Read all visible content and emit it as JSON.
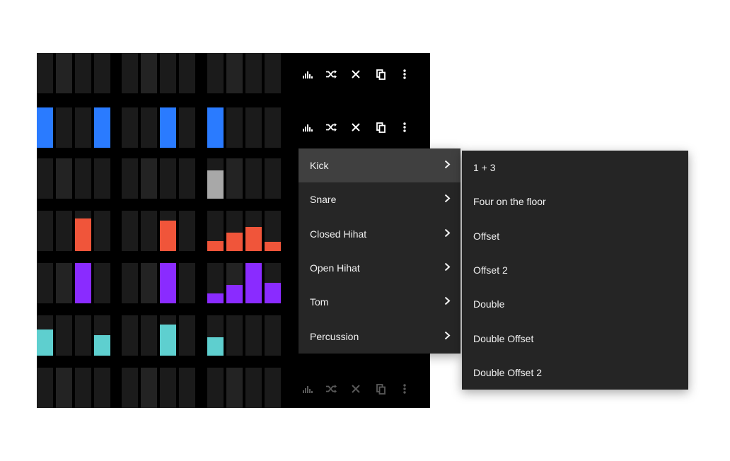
{
  "sequencer": {
    "tracks": [
      {
        "color": "#2a7bff",
        "steps": [
          0,
          0,
          0,
          0,
          0,
          0,
          0,
          0,
          0,
          0,
          0,
          0
        ]
      },
      {
        "color": "#2a7bff",
        "steps": [
          1,
          0,
          0,
          1,
          0,
          0,
          1,
          0,
          1,
          0,
          0,
          0
        ]
      },
      {
        "color": "#a8a8a8",
        "steps": [
          0,
          0,
          0,
          0,
          0,
          0,
          0,
          0,
          0.7,
          0,
          0,
          0
        ]
      },
      {
        "color": "#f0553a",
        "steps": [
          0,
          0,
          0.8,
          0,
          0,
          0,
          0.75,
          0,
          0.25,
          0.45,
          0.6,
          0.22
        ]
      },
      {
        "color": "#8a2bff",
        "steps": [
          0,
          0,
          1,
          0,
          0,
          0,
          1,
          0,
          0.25,
          0.45,
          1,
          0.5
        ]
      },
      {
        "color": "#5ecfcf",
        "steps": [
          0.65,
          0,
          0,
          0.5,
          0,
          0,
          0.78,
          0,
          0.45,
          0,
          0,
          0
        ]
      },
      {
        "color": "#2a7bff",
        "steps": [
          0,
          0,
          0,
          0,
          0,
          0,
          0,
          0,
          0,
          0,
          0,
          0
        ]
      }
    ],
    "row_tools": [
      {
        "dim": false,
        "icons": [
          "velocity-icon",
          "shuffle-icon",
          "clear-icon",
          "copy-icon",
          "more-icon"
        ]
      },
      {
        "dim": false,
        "icons": [
          "velocity-icon",
          "shuffle-icon",
          "clear-icon",
          "copy-icon",
          "more-icon"
        ]
      },
      {
        "dim": true,
        "icons": [
          "velocity-icon",
          "shuffle-icon",
          "clear-icon",
          "copy-icon",
          "more-icon"
        ]
      }
    ]
  },
  "track_menu": {
    "items": [
      {
        "label": "Kick",
        "active": true
      },
      {
        "label": "Snare",
        "active": false
      },
      {
        "label": "Closed Hihat",
        "active": false
      },
      {
        "label": "Open Hihat",
        "active": false
      },
      {
        "label": "Tom",
        "active": false
      },
      {
        "label": "Percussion",
        "active": false
      }
    ]
  },
  "pattern_menu": {
    "items": [
      {
        "label": "1 + 3"
      },
      {
        "label": "Four on the floor"
      },
      {
        "label": "Offset"
      },
      {
        "label": "Offset 2"
      },
      {
        "label": "Double"
      },
      {
        "label": "Double Offset"
      },
      {
        "label": "Double Offset 2"
      }
    ]
  },
  "colors": {
    "menu_bg": "#262626",
    "menu_active": "#404040",
    "text": "#f2f2f2"
  }
}
